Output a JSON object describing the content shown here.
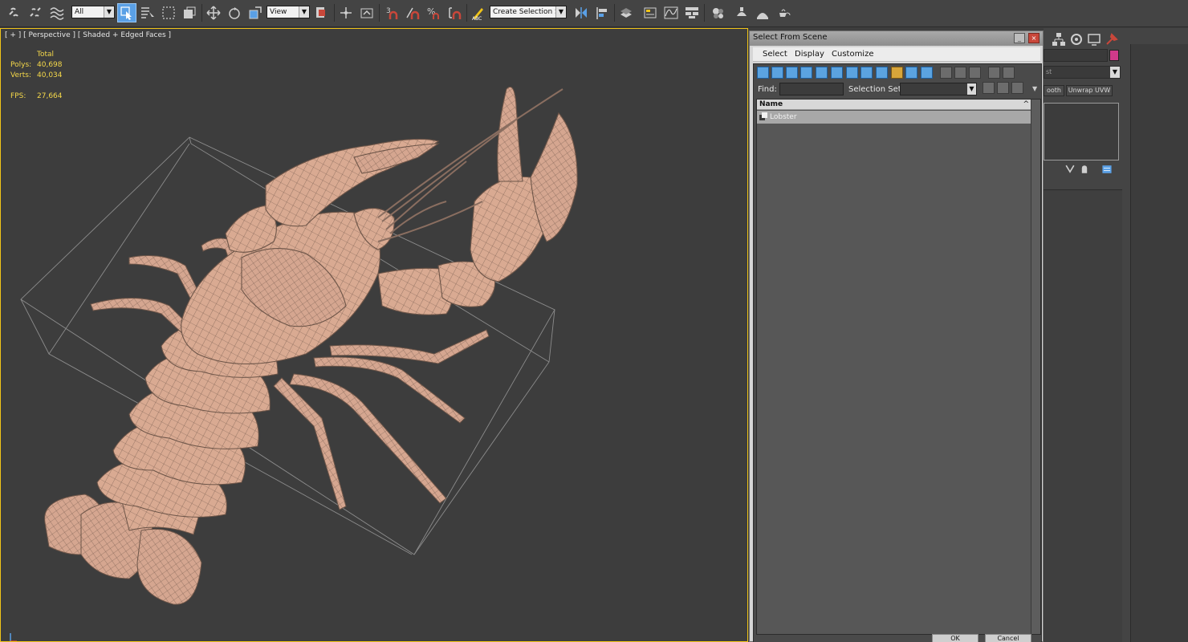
{
  "toolbar": {
    "filter_value": "All",
    "ref_coord_value": "View",
    "snaps_3_label": "3",
    "percent_snap_label": "%",
    "named_selection_placeholder": "Create Selection Se"
  },
  "viewport": {
    "label": "[ + ] [ Perspective ] [ Shaded + Edged Faces ]",
    "stats": {
      "total_label": "Total",
      "polys_label": "Polys:",
      "polys_value": "40,698",
      "verts_label": "Verts:",
      "verts_value": "40,034",
      "fps_label": "FPS:",
      "fps_value": "27,664"
    }
  },
  "dialog": {
    "title": "Select From Scene",
    "menu": [
      "Select",
      "Display",
      "Customize"
    ],
    "find_label": "Find:",
    "find_value": "",
    "selection_set_label": "Selection Set:",
    "column_header": "Name",
    "sort_indicator": "^",
    "objects": [
      {
        "name": "Lobster",
        "selected": true
      }
    ],
    "ok_label": "OK",
    "cancel_label": "Cancel"
  },
  "command_panel": {
    "modifier_list_partial": "st",
    "color_swatch": "#d03a8a",
    "button_smooth_partial": "ooth",
    "button_unwrap": "Unwrap UVW"
  },
  "colors": {
    "viewport_bg": "#3d3d3d",
    "active_border": "#f0c418",
    "stats_text": "#f5d84a",
    "mesh_fill": "#d9aa92",
    "mesh_wire": "#6d5548",
    "toolbar_bg": "#444444",
    "selection_blue": "#5aa0e6"
  }
}
